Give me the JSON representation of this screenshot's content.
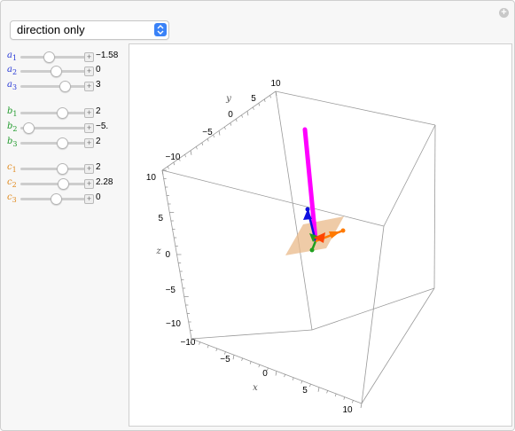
{
  "dropdown": {
    "selected": "direction only"
  },
  "corner_icon": "plus-circle-icon",
  "controls": [
    {
      "id": "a1",
      "letter": "a",
      "sub": "1",
      "value": "−1.58",
      "knob": 0.38,
      "color": "#2a3bd6"
    },
    {
      "id": "a2",
      "letter": "a",
      "sub": "2",
      "value": "0",
      "knob": 0.5,
      "color": "#2a3bd6"
    },
    {
      "id": "a3",
      "letter": "a",
      "sub": "3",
      "value": "3",
      "knob": 0.65,
      "color": "#2a3bd6"
    },
    {
      "id": "b1",
      "letter": "b",
      "sub": "1",
      "value": "2",
      "knob": 0.6,
      "color": "#1f9a2a"
    },
    {
      "id": "b2",
      "letter": "b",
      "sub": "2",
      "value": "−5.",
      "knob": 0.05,
      "color": "#1f9a2a"
    },
    {
      "id": "b3",
      "letter": "b",
      "sub": "3",
      "value": "2",
      "knob": 0.6,
      "color": "#1f9a2a"
    },
    {
      "id": "c1",
      "letter": "c",
      "sub": "1",
      "value": "2",
      "knob": 0.6,
      "color": "#e08a1e"
    },
    {
      "id": "c2",
      "letter": "c",
      "sub": "2",
      "value": "2.28",
      "knob": 0.62,
      "color": "#e08a1e"
    },
    {
      "id": "c3",
      "letter": "c",
      "sub": "3",
      "value": "0",
      "knob": 0.5,
      "color": "#e08a1e"
    }
  ],
  "plot": {
    "axes": {
      "x_label": "x",
      "y_label": "y",
      "z_label": "z"
    },
    "y_ticks": [
      "10",
      "5",
      "0",
      "−5",
      "−10"
    ],
    "z_ticks": [
      "10",
      "5",
      "0",
      "−5",
      "−10"
    ],
    "x_ticks": [
      "−10",
      "−5",
      "0",
      "5",
      "10"
    ],
    "colors": {
      "a": "#1010e0",
      "b": "#1fa01f",
      "c": "#ff7a00",
      "cross": "#ff00ff",
      "plane": "#e9b98a"
    }
  }
}
